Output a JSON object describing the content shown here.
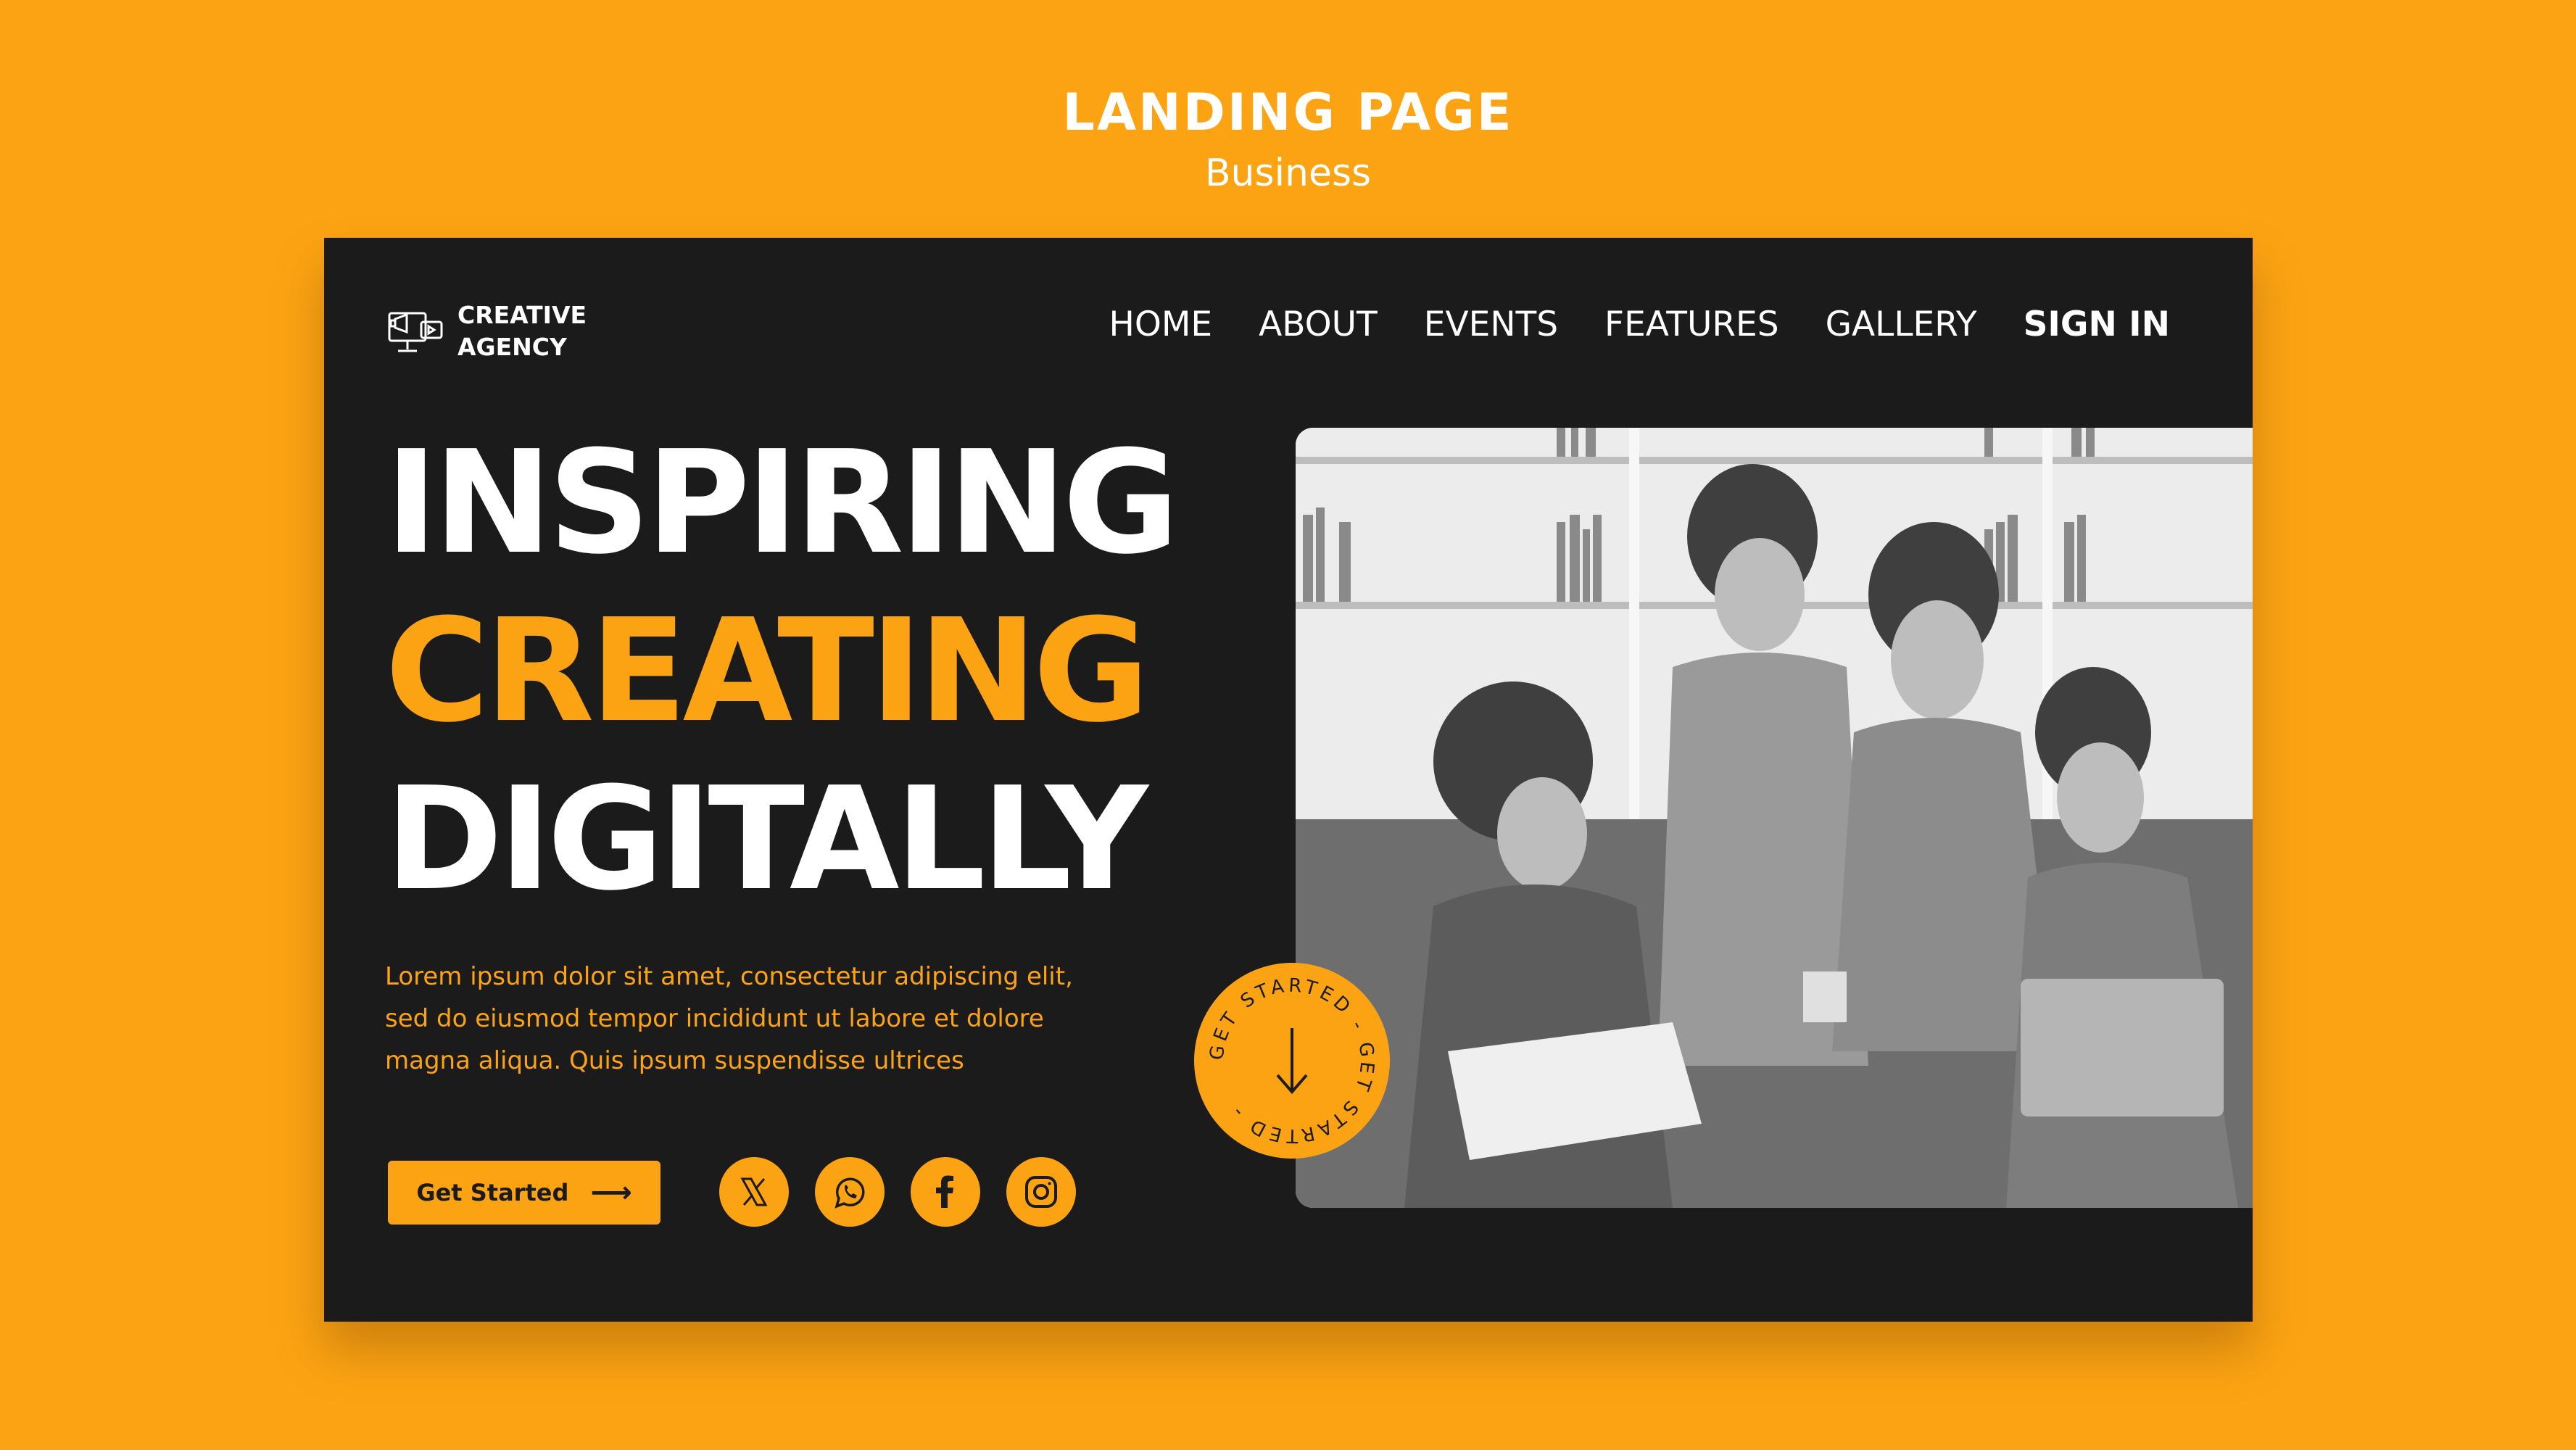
{
  "page_header": {
    "title": "LANDING PAGE",
    "subtitle": "Business"
  },
  "logo": {
    "line1": "CREATIVE",
    "line2": "AGENCY",
    "icon": "megaphone-monitor-icon"
  },
  "nav": {
    "items": [
      "HOME",
      "ABOUT",
      "EVENTS",
      "FEATURES",
      "GALLERY"
    ],
    "signin": "SIGN IN"
  },
  "hero": {
    "line1": "INSPIRING",
    "line2": "CREATING",
    "line3": "DIGITALLY",
    "description": "Lorem ipsum dolor sit amet, consectetur adipiscing elit, sed do eiusmod tempor incididunt ut labore et dolore magna aliqua. Quis ipsum suspendisse ultrices"
  },
  "cta": {
    "label": "Get Started",
    "icon": "arrow-right-icon"
  },
  "socials": [
    {
      "icon": "x-twitter-icon"
    },
    {
      "icon": "whatsapp-icon"
    },
    {
      "icon": "facebook-icon"
    },
    {
      "icon": "instagram-icon"
    }
  ],
  "badge": {
    "text": "GET STARTED - GET STARTED - ",
    "icon": "arrow-down-icon"
  },
  "colors": {
    "accent": "#FCA313",
    "dark": "#1b1b1b",
    "white": "#ffffff"
  }
}
